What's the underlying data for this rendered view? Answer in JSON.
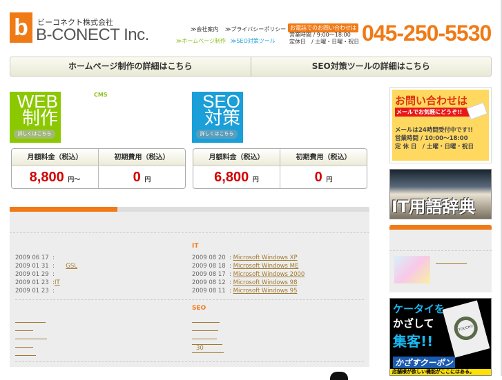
{
  "header": {
    "logo_glyph": "b",
    "company_jp": "ビーコネクト株式会社",
    "company_en": "B-CONECT Inc.",
    "links": [
      "≫会社案内",
      "≫プライバシーポリシー",
      "≫ホームページ制作",
      "≫SEO対策ツール"
    ],
    "contact_badge": "お電話でのお問い合わせは",
    "hours": "営業時間 / 9:00〜18:00",
    "holiday": "定休日　/ 土曜・日曜・祝日",
    "phone": "045-250-5530"
  },
  "nav": {
    "items": [
      "ホームページ制作の詳細はこちら",
      "SEO対策ツールの詳細はこちら"
    ]
  },
  "services": [
    {
      "tile_line1": "WEB",
      "tile_line2": "制作",
      "button": "詳しくはこちら",
      "tag": "CMS",
      "color": "#8cc800",
      "headers": [
        "月額料金（税込）",
        "初期費用（税込）"
      ],
      "monthly": "8,800",
      "monthly_unit": "円〜",
      "initial": "0",
      "initial_unit": "円"
    },
    {
      "tile_line1": "SEO",
      "tile_line2": "対策",
      "button": "詳しくはこちら",
      "tag": "",
      "color": "#1a9fd8",
      "headers": [
        "月額料金（税込）",
        "初期費用（税込）"
      ],
      "monthly": "6,800",
      "monthly_unit": "円",
      "initial": "0",
      "initial_unit": "円"
    }
  ],
  "news": {
    "left": [
      {
        "date": "2009 06 17",
        "title": ""
      },
      {
        "date": "2009 01 31",
        "title": "GSL"
      },
      {
        "date": "2009 01 29",
        "title": ""
      },
      {
        "date": "2009 01 23",
        "title": "IT"
      },
      {
        "date": "2009 01 23",
        "title": ""
      }
    ],
    "it_heading": "IT",
    "right": [
      {
        "date": "2009 08 20",
        "title": "Microsoft Windows XP"
      },
      {
        "date": "2009 08 18",
        "title": "Microsoft Windows ME"
      },
      {
        "date": "2009 08 17",
        "title": "Microsoft Windows 2000"
      },
      {
        "date": "2009 08 12",
        "title": "Microsoft Windows 98"
      },
      {
        "date": "2009 08 11",
        "title": "Microsoft Windows 95"
      }
    ],
    "seo_heading": "SEO",
    "seo_last": "30"
  },
  "sidebar": {
    "contact_title": "お問い合わせは",
    "contact_sub": "メールでお気軽にどうぞ!!",
    "contact_l1": "メールは24時間受付中です!!",
    "contact_l2": "営業時間 / 10:00〜18:00",
    "contact_l3": "定 休 日　/ 土曜・日曜・祝日",
    "dict": "IT用語辞典",
    "coupon_l1": "ケータイを",
    "coupon_l2": "かざして",
    "coupon_l3": "集客!!",
    "coupon_brand": "かざすクーポン",
    "coupon_foot": "店舗様が欲しい機能がここにはある。",
    "touch": "TOUCH!!"
  }
}
